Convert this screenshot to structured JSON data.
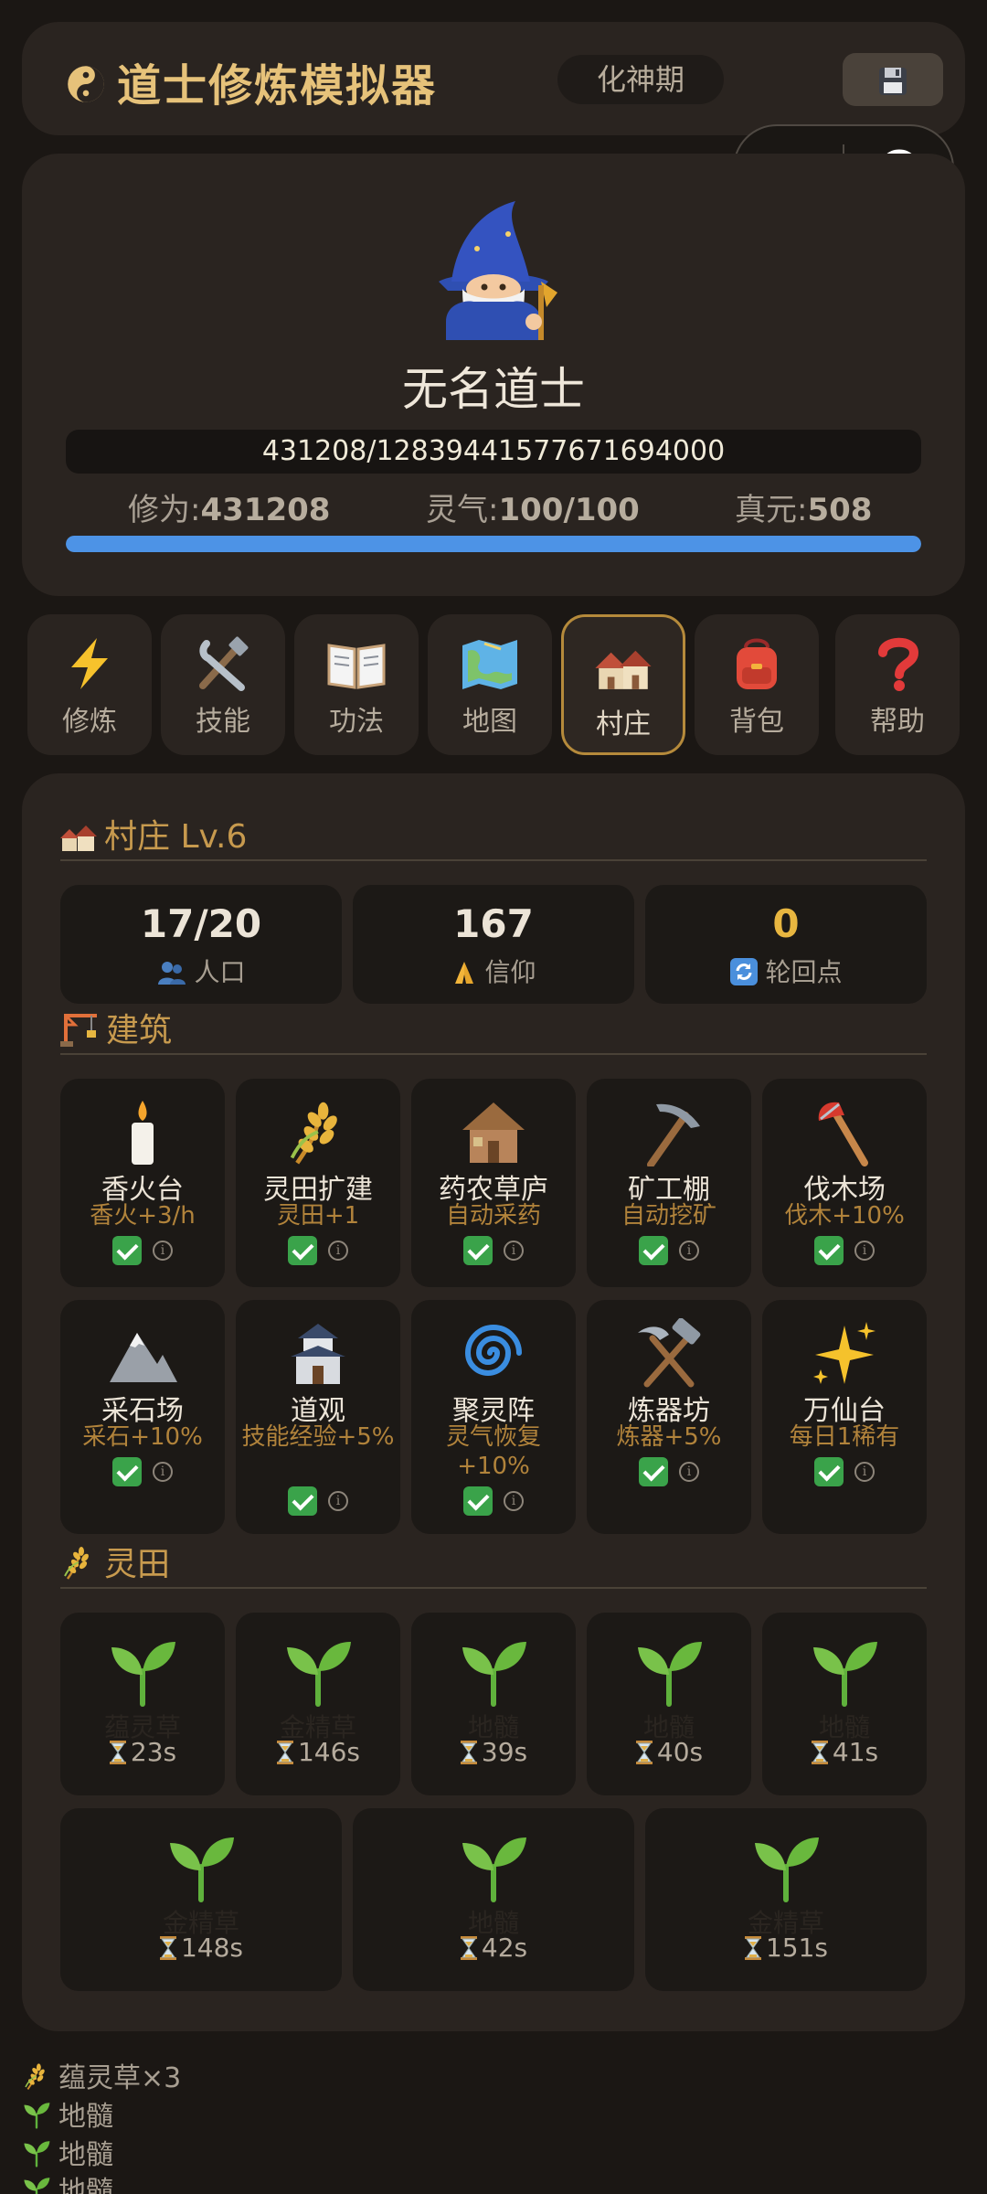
{
  "header": {
    "app_title": "道士修炼模拟器",
    "realm": "化神期",
    "save_icon": "floppy-disk-icon"
  },
  "mini_capsule": {
    "more_icon": "more-dots-icon",
    "close_icon": "target-circle-icon"
  },
  "profile": {
    "name": "无名道士",
    "exp_text": "431208/12839441577671694000",
    "stats": [
      {
        "label": "修为:",
        "value": "431208"
      },
      {
        "label": "灵气:",
        "value": "100/100"
      },
      {
        "label": "真元:",
        "value": "508"
      }
    ],
    "spirit_fraction": 1.0,
    "bar_color": "#4d93e6"
  },
  "nav": [
    {
      "label": "修炼",
      "icon": "lightning-icon"
    },
    {
      "label": "技能",
      "icon": "tools-icon"
    },
    {
      "label": "功法",
      "icon": "book-icon"
    },
    {
      "label": "地图",
      "icon": "map-icon"
    },
    {
      "label": "村庄",
      "icon": "village-icon",
      "active": true
    },
    {
      "label": "背包",
      "icon": "backpack-icon"
    },
    {
      "label": "帮助",
      "icon": "question-icon"
    }
  ],
  "village": {
    "title": "村庄 Lv.6",
    "summary": [
      {
        "value": "17/20",
        "label": "人口",
        "icon": "people-icon"
      },
      {
        "value": "167",
        "label": "信仰",
        "icon": "pray-icon"
      },
      {
        "value": "0",
        "label": "轮回点",
        "icon": "cycle-icon"
      }
    ],
    "buildings_title": "建筑",
    "buildings": [
      {
        "name": "香火台",
        "effect": "香火+3/h",
        "icon": "candle-icon"
      },
      {
        "name": "灵田扩建",
        "effect": "灵田+1",
        "icon": "rice-icon"
      },
      {
        "name": "药农草庐",
        "effect": "自动采药",
        "icon": "hut-icon"
      },
      {
        "name": "矿工棚",
        "effect": "自动挖矿",
        "icon": "pickaxe-icon"
      },
      {
        "name": "伐木场",
        "effect": "伐木+10%",
        "icon": "axe-icon"
      },
      {
        "name": "采石场",
        "effect": "采石+10%",
        "icon": "mountain-icon"
      },
      {
        "name": "道观",
        "effect": "技能经验+5%",
        "icon": "castle-icon"
      },
      {
        "name": "聚灵阵",
        "effect": "灵气恢复+10%",
        "icon": "cyclone-icon"
      },
      {
        "name": "炼器坊",
        "effect": "炼器+5%",
        "icon": "hammer-pick-icon"
      },
      {
        "name": "万仙台",
        "effect": "每日1稀有",
        "icon": "sparkles-icon"
      }
    ],
    "fields_title": "灵田",
    "fields": [
      {
        "crop": "蕴灵草",
        "time": "23s"
      },
      {
        "crop": "金精草",
        "time": "146s"
      },
      {
        "crop": "地髓",
        "time": "39s"
      },
      {
        "crop": "地髓",
        "time": "40s"
      },
      {
        "crop": "地髓",
        "time": "41s"
      },
      {
        "crop": "金精草",
        "time": "148s"
      },
      {
        "crop": "地髓",
        "time": "42s"
      },
      {
        "crop": "金精草",
        "time": "151s"
      }
    ]
  },
  "harvest_log": [
    {
      "text": "蕴灵草×3",
      "icon": "rice-icon"
    },
    {
      "text": "地髓",
      "icon": "sprout-icon"
    },
    {
      "text": "地髓",
      "icon": "sprout-icon"
    },
    {
      "text": "地髓",
      "icon": "sprout-icon"
    }
  ]
}
